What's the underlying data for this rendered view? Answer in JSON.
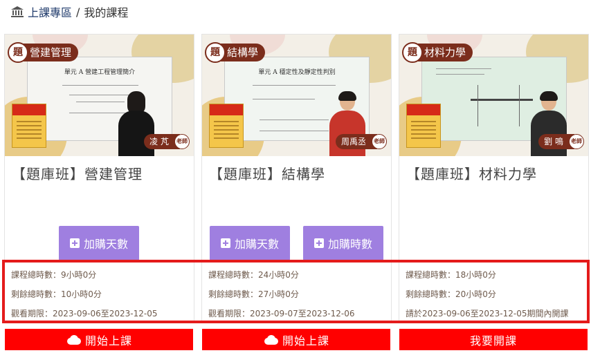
{
  "breadcrumb": {
    "home_label": "上課專區",
    "separator": "/",
    "current": "我的課程"
  },
  "courses": [
    {
      "tag_circle": "題",
      "tag_label": "營建管理",
      "screen_title": "單元 A  營建工程管理簡介",
      "teacher_name": "凌 芃",
      "teacher_badge": "老師",
      "title": "【題庫班】營建管理",
      "buttons": [
        "加購天數"
      ],
      "info": [
        "課程總時數：9小時0分",
        "剩餘總時數：10小時0分",
        "觀看期限：2023-09-06至2023-12-05"
      ],
      "action": "開始上課",
      "action_icon": "cloud-icon"
    },
    {
      "tag_circle": "題",
      "tag_label": "結構學",
      "screen_title": "單元 A  穩定性及靜定性判別",
      "teacher_name": "周禹丞",
      "teacher_badge": "老師",
      "title": "【題庫班】結構學",
      "buttons": [
        "加購天數",
        "加購時數"
      ],
      "info": [
        "課程總時數：24小時0分",
        "剩餘總時數：27小時0分",
        "觀看期限：2023-09-07至2023-12-06"
      ],
      "action": "開始上課",
      "action_icon": "cloud-icon"
    },
    {
      "tag_circle": "題",
      "tag_label": "材料力學",
      "screen_title": "",
      "teacher_name": "劉 鳴",
      "teacher_badge": "老師",
      "title": "【題庫班】材料力學",
      "buttons": [],
      "info": [
        "課程總時數：18小時0分",
        "剩餘總時數：20小時0分",
        "請於2023-09-06至2023-12-05期間內開課"
      ],
      "action": "我要開課",
      "action_icon": ""
    }
  ],
  "colors": {
    "accent_purple": "#9f7fe0",
    "action_red": "#ff0000",
    "highlight_red": "#e41b1b",
    "tag_brown": "#7b2d1c",
    "link_blue": "#1f3a6b"
  }
}
